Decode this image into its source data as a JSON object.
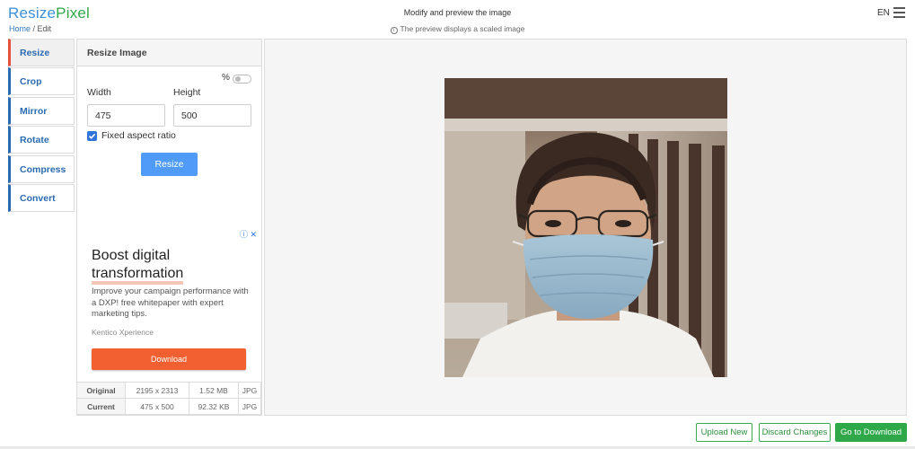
{
  "brand": {
    "part1": "Resize",
    "part2": "Pixel"
  },
  "breadcrumb": {
    "home": "Home",
    "sep": " / ",
    "current": "Edit"
  },
  "header": {
    "title": "Modify and preview the image",
    "note": "The preview displays a scaled image",
    "lang": "EN"
  },
  "sidebar": {
    "items": [
      {
        "label": "Resize",
        "active": true
      },
      {
        "label": "Crop"
      },
      {
        "label": "Mirror"
      },
      {
        "label": "Rotate"
      },
      {
        "label": "Compress"
      },
      {
        "label": "Convert"
      }
    ]
  },
  "resize": {
    "title": "Resize Image",
    "percent_label": "%",
    "width_label": "Width",
    "height_label": "Height",
    "width_value": "475",
    "height_value": "500",
    "aspect_label": "Fixed aspect ratio",
    "aspect_checked": true,
    "button": "Resize"
  },
  "ad": {
    "title_line1": "Boost digital",
    "title_line2": "transformation",
    "body": "Improve your campaign performance with a DXP! free whitepaper with expert marketing tips.",
    "brand": "Kentico Xperience",
    "button": "Download"
  },
  "info": {
    "rows": [
      {
        "label": "Original",
        "dims": "2195 x 2313",
        "size": "1.52 MB",
        "format": "JPG"
      },
      {
        "label": "Current",
        "dims": "475 x 500",
        "size": "92.32 KB",
        "format": "JPG"
      }
    ]
  },
  "actions": {
    "upload": "Upload New",
    "discard": "Discard Changes",
    "download": "Go to Download"
  },
  "colors": {
    "blue": "#2a6ab0",
    "green": "#2fa84a",
    "accent_red": "#e84e3d",
    "button_blue": "#4f9bf7",
    "ad_orange": "#f26031"
  }
}
